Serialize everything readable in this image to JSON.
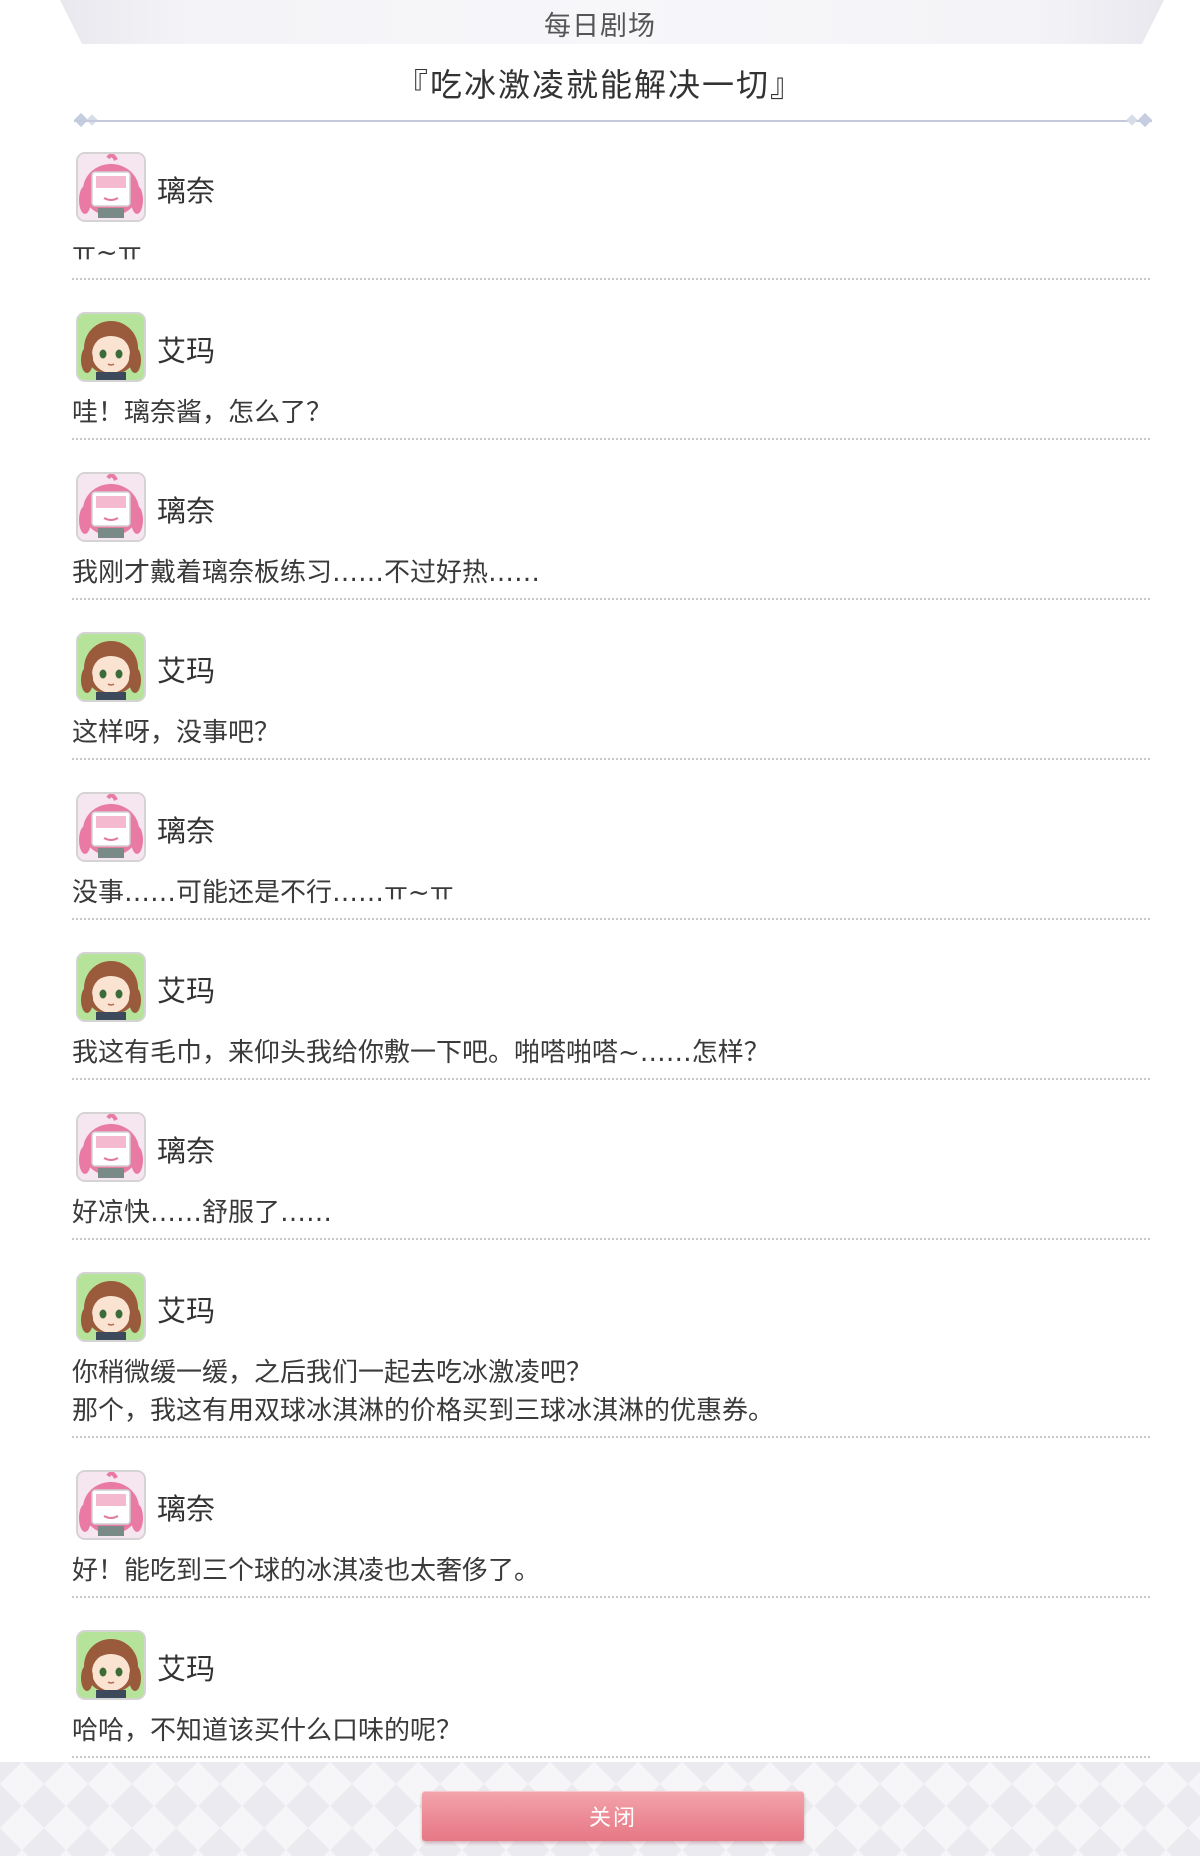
{
  "header": {
    "title": "每日剧场"
  },
  "story": {
    "title": "『吃冰激凌就能解决一切』"
  },
  "colors": {
    "accent": "#ec8a95",
    "emma_avatar_bg": "#b6e39a",
    "rina_avatar_bg": "#f6e6ef",
    "rina_hair": "#e97aa3",
    "emma_hair": "#9a5a3c"
  },
  "dialogue": [
    {
      "speaker": "璃奈",
      "avatar": "rina-avatar",
      "lines": [
        "ㅠ~ㅠ"
      ]
    },
    {
      "speaker": "艾玛",
      "avatar": "emma-avatar",
      "lines": [
        "哇！璃奈酱，怎么了？"
      ]
    },
    {
      "speaker": "璃奈",
      "avatar": "rina-avatar",
      "lines": [
        "我刚才戴着璃奈板练习……不过好热……"
      ]
    },
    {
      "speaker": "艾玛",
      "avatar": "emma-avatar",
      "lines": [
        "这样呀，没事吧？"
      ]
    },
    {
      "speaker": "璃奈",
      "avatar": "rina-avatar",
      "lines": [
        "没事……可能还是不行……ㅠ~ㅠ"
      ]
    },
    {
      "speaker": "艾玛",
      "avatar": "emma-avatar",
      "lines": [
        "我这有毛巾，来仰头我给你敷一下吧。啪嗒啪嗒~……怎样？"
      ]
    },
    {
      "speaker": "璃奈",
      "avatar": "rina-avatar",
      "lines": [
        "好凉快……舒服了……"
      ]
    },
    {
      "speaker": "艾玛",
      "avatar": "emma-avatar",
      "lines": [
        "你稍微缓一缓，之后我们一起去吃冰激凌吧？",
        "那个，我这有用双球冰淇淋的价格买到三球冰淇淋的优惠券。"
      ]
    },
    {
      "speaker": "璃奈",
      "avatar": "rina-avatar",
      "lines": [
        "好！能吃到三个球的冰淇凌也太奢侈了。"
      ]
    },
    {
      "speaker": "艾玛",
      "avatar": "emma-avatar",
      "lines": [
        "哈哈，不知道该买什么口味的呢？"
      ]
    }
  ],
  "footer": {
    "close_label": "关闭"
  }
}
